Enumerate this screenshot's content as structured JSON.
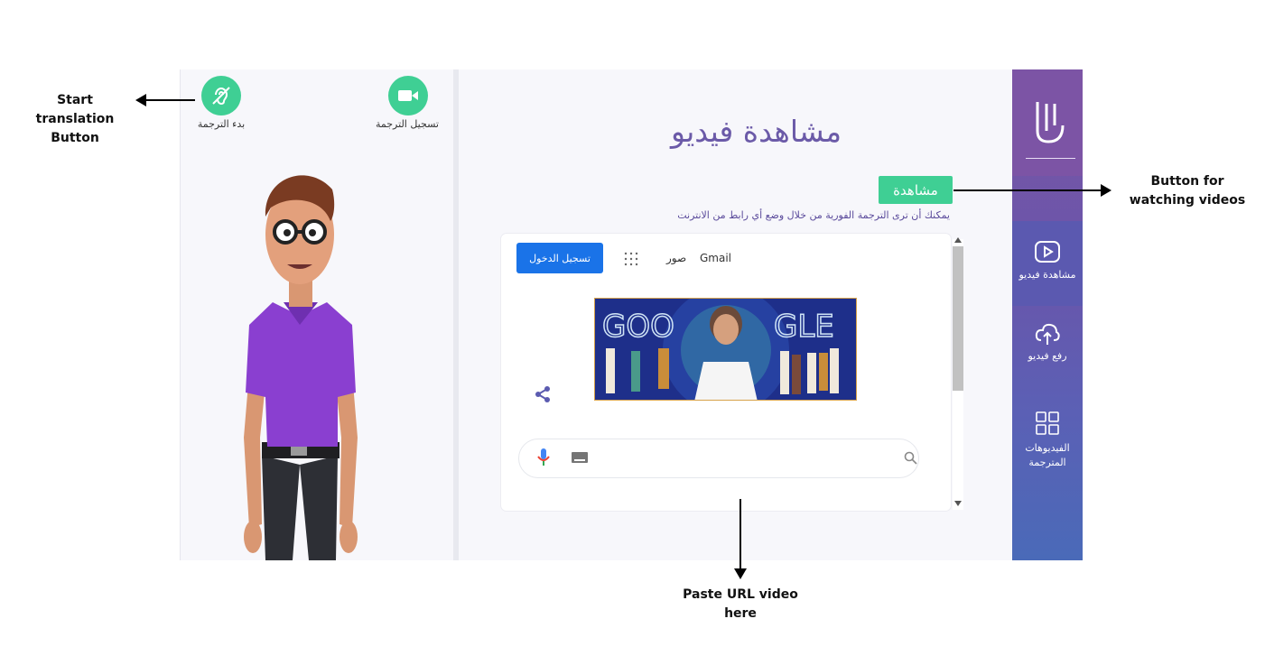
{
  "annotations": {
    "start_translation": "Start translation\nButton",
    "watch_videos": "Button for\nwatching videos",
    "paste_url": "Paste URL video\nhere"
  },
  "controls": {
    "record_label": "تسجيل الترجمة",
    "start_label": "بدء الترجمة"
  },
  "main": {
    "title": "مشاهدة فيديو",
    "watch_button": "مشاهدة",
    "hint": "يمكنك أن ترى الترجمة الفورية من خلال وضع أي رابط من الانترنت"
  },
  "browser": {
    "login_button": "تسجيل الدخول",
    "nav_gmail": "Gmail",
    "nav_images": "صور",
    "doodle_text": "GOOGLE"
  },
  "sidebar": {
    "items": [
      {
        "label": "مشاهدة فيديو",
        "icon": "play-icon"
      },
      {
        "label": "رفع فيديو",
        "icon": "upload-cloud-icon"
      },
      {
        "label": "الفيديوهات المترجمة",
        "icon": "grid-icon"
      }
    ]
  },
  "colors": {
    "accent_green": "#3fcf94",
    "brand_purple": "#6b5aa8",
    "google_blue": "#1a73e8"
  }
}
